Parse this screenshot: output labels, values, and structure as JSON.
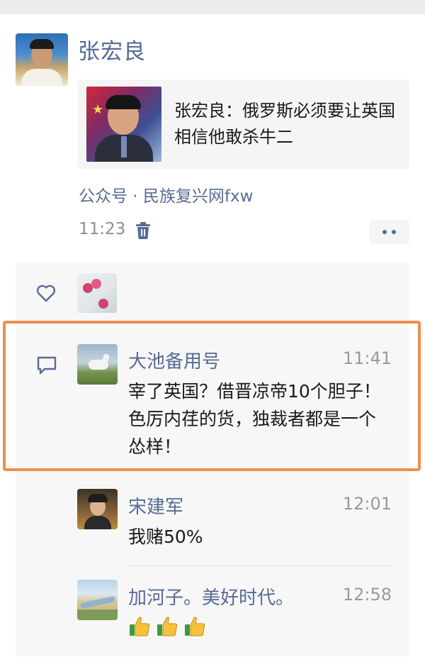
{
  "post": {
    "author_name": "张宏良",
    "article_title": "张宏良：俄罗斯必须要让英国相信他敢杀牛二",
    "source": "公众号 · 民族复兴网fxw",
    "time": "11:23"
  },
  "comments": [
    {
      "name": "大池备用号",
      "time": "11:41",
      "text": "宰了英国？借晋凉帝10个胆子！色厉内荏的货，独裁者都是一个怂样！"
    },
    {
      "name": "宋建军",
      "time": "12:01",
      "text": "我赌50%"
    },
    {
      "name": "加河子。美好时代。",
      "time": "12:58",
      "emoji": "thumbs-up-icon ×3"
    }
  ],
  "colors": {
    "link": "#576b95",
    "highlight_border": "#ee8f4c",
    "panel_background": "#f7f7f7"
  }
}
